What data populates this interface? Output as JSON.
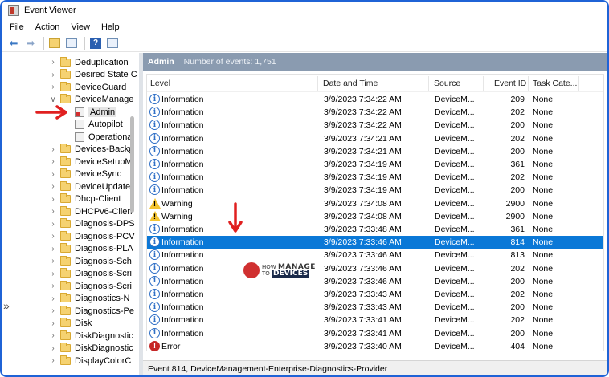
{
  "window": {
    "title": "Event Viewer"
  },
  "menu": [
    "File",
    "Action",
    "View",
    "Help"
  ],
  "tree": {
    "items": [
      {
        "label": "Deduplication",
        "expanded": false,
        "level": 0
      },
      {
        "label": "Desired State C",
        "expanded": false,
        "level": 0
      },
      {
        "label": "DeviceGuard",
        "expanded": false,
        "level": 0
      },
      {
        "label": "DeviceManage",
        "expanded": true,
        "level": 0
      },
      {
        "label": "Admin",
        "level": 1,
        "selected": true
      },
      {
        "label": "Autopilot",
        "level": 1
      },
      {
        "label": "Operationa",
        "level": 1
      },
      {
        "label": "Devices-Backg",
        "expanded": false,
        "level": 0
      },
      {
        "label": "DeviceSetupM",
        "expanded": false,
        "level": 0
      },
      {
        "label": "DeviceSync",
        "expanded": false,
        "level": 0
      },
      {
        "label": "DeviceUpdate/",
        "expanded": false,
        "level": 0
      },
      {
        "label": "Dhcp-Client",
        "expanded": false,
        "level": 0
      },
      {
        "label": "DHCPv6-Clien",
        "expanded": false,
        "level": 0
      },
      {
        "label": "Diagnosis-DPS",
        "expanded": false,
        "level": 0
      },
      {
        "label": "Diagnosis-PCV",
        "expanded": false,
        "level": 0
      },
      {
        "label": "Diagnosis-PLA",
        "expanded": false,
        "level": 0
      },
      {
        "label": "Diagnosis-Sch",
        "expanded": false,
        "level": 0
      },
      {
        "label": "Diagnosis-Scri",
        "expanded": false,
        "level": 0
      },
      {
        "label": "Diagnosis-Scri",
        "expanded": false,
        "level": 0
      },
      {
        "label": "Diagnostics-N",
        "expanded": false,
        "level": 0
      },
      {
        "label": "Diagnostics-Pe",
        "expanded": false,
        "level": 0
      },
      {
        "label": "Disk",
        "expanded": false,
        "level": 0
      },
      {
        "label": "DiskDiagnostic",
        "expanded": false,
        "level": 0
      },
      {
        "label": "DiskDiagnostic",
        "expanded": false,
        "level": 0
      },
      {
        "label": "DisplayColorC",
        "expanded": false,
        "level": 0
      }
    ]
  },
  "main": {
    "log_name": "Admin",
    "count_label": "Number of events: 1,751",
    "columns": [
      "Level",
      "Date and Time",
      "Source",
      "Event ID",
      "Task Cate..."
    ],
    "rows": [
      {
        "level": "Information",
        "icon": "info-icon",
        "date": "3/9/2023 7:34:22 AM",
        "source": "DeviceM...",
        "id": "209",
        "task": "None"
      },
      {
        "level": "Information",
        "icon": "info-icon",
        "date": "3/9/2023 7:34:22 AM",
        "source": "DeviceM...",
        "id": "202",
        "task": "None"
      },
      {
        "level": "Information",
        "icon": "info-icon",
        "date": "3/9/2023 7:34:22 AM",
        "source": "DeviceM...",
        "id": "200",
        "task": "None"
      },
      {
        "level": "Information",
        "icon": "info-icon",
        "date": "3/9/2023 7:34:21 AM",
        "source": "DeviceM...",
        "id": "202",
        "task": "None"
      },
      {
        "level": "Information",
        "icon": "info-icon",
        "date": "3/9/2023 7:34:21 AM",
        "source": "DeviceM...",
        "id": "200",
        "task": "None"
      },
      {
        "level": "Information",
        "icon": "info-icon",
        "date": "3/9/2023 7:34:19 AM",
        "source": "DeviceM...",
        "id": "361",
        "task": "None"
      },
      {
        "level": "Information",
        "icon": "info-icon",
        "date": "3/9/2023 7:34:19 AM",
        "source": "DeviceM...",
        "id": "202",
        "task": "None"
      },
      {
        "level": "Information",
        "icon": "info-icon",
        "date": "3/9/2023 7:34:19 AM",
        "source": "DeviceM...",
        "id": "200",
        "task": "None"
      },
      {
        "level": "Warning",
        "icon": "warning-icon",
        "date": "3/9/2023 7:34:08 AM",
        "source": "DeviceM...",
        "id": "2900",
        "task": "None"
      },
      {
        "level": "Warning",
        "icon": "warning-icon",
        "date": "3/9/2023 7:34:08 AM",
        "source": "DeviceM...",
        "id": "2900",
        "task": "None"
      },
      {
        "level": "Information",
        "icon": "info-icon",
        "date": "3/9/2023 7:33:48 AM",
        "source": "DeviceM...",
        "id": "361",
        "task": "None"
      },
      {
        "level": "Information",
        "icon": "info-icon",
        "date": "3/9/2023 7:33:46 AM",
        "source": "DeviceM...",
        "id": "814",
        "task": "None",
        "selected": true
      },
      {
        "level": "Information",
        "icon": "info-icon",
        "date": "3/9/2023 7:33:46 AM",
        "source": "DeviceM...",
        "id": "813",
        "task": "None"
      },
      {
        "level": "Information",
        "icon": "info-icon",
        "date": "3/9/2023 7:33:46 AM",
        "source": "DeviceM...",
        "id": "202",
        "task": "None"
      },
      {
        "level": "Information",
        "icon": "info-icon",
        "date": "3/9/2023 7:33:46 AM",
        "source": "DeviceM...",
        "id": "200",
        "task": "None"
      },
      {
        "level": "Information",
        "icon": "info-icon",
        "date": "3/9/2023 7:33:43 AM",
        "source": "DeviceM...",
        "id": "202",
        "task": "None"
      },
      {
        "level": "Information",
        "icon": "info-icon",
        "date": "3/9/2023 7:33:43 AM",
        "source": "DeviceM...",
        "id": "200",
        "task": "None"
      },
      {
        "level": "Information",
        "icon": "info-icon",
        "date": "3/9/2023 7:33:41 AM",
        "source": "DeviceM...",
        "id": "202",
        "task": "None"
      },
      {
        "level": "Information",
        "icon": "info-icon",
        "date": "3/9/2023 7:33:41 AM",
        "source": "DeviceM...",
        "id": "200",
        "task": "None"
      },
      {
        "level": "Error",
        "icon": "error-icon",
        "date": "3/9/2023 7:33:40 AM",
        "source": "DeviceM...",
        "id": "404",
        "task": "None"
      }
    ]
  },
  "status": {
    "text": "Event 814, DeviceManagement-Enterprise-Diagnostics-Provider"
  },
  "watermark": {
    "line1": "HOW",
    "line2": "TO",
    "brand1": "MANAGE",
    "brand2": "DEVICES"
  },
  "colors": {
    "frame": "#1f63d6",
    "header_bar": "#8a9bb0",
    "selection": "#0a78d7",
    "arrow": "#e02020"
  }
}
